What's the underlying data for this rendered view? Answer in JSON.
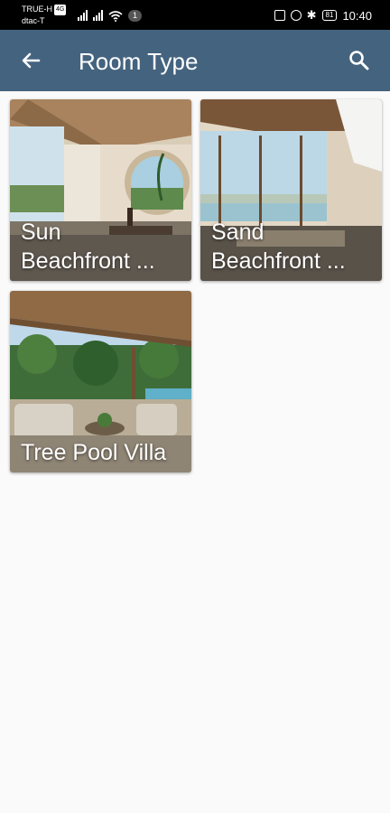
{
  "status_bar": {
    "carrier_line1": "TRUE-H",
    "carrier_badge": "4G",
    "carrier_line2": "dtac-T",
    "notification_count": "1",
    "battery": "81",
    "time": "10:40"
  },
  "app_bar": {
    "title": "Room Type",
    "back_icon": "arrow-back-icon",
    "search_icon": "search-icon",
    "background_color": "#44637f"
  },
  "room_types": [
    {
      "line1": "Sun",
      "line2": "Beachfront ..."
    },
    {
      "line1": "Sand",
      "line2": "Beachfront ..."
    },
    {
      "line1": "Tree Pool Villa",
      "line2": ""
    }
  ]
}
